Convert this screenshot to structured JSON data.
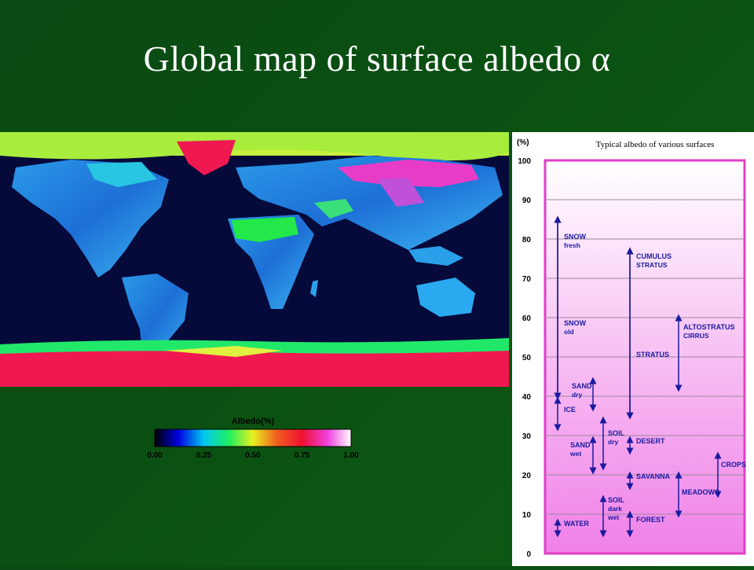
{
  "slide": {
    "title": "Global map of surface albedo α"
  },
  "legend": {
    "title": "Albedo(%)",
    "ticks": [
      "0.00",
      "0.25",
      "0.50",
      "0.75",
      "1.00"
    ]
  },
  "chart": {
    "caption": "Typical albedo of various surfaces",
    "unit_label": "(%)",
    "y_ticks": [
      "100",
      "90",
      "80",
      "70",
      "60",
      "50",
      "40",
      "30",
      "20",
      "10",
      "0"
    ],
    "colors": {
      "frame": "#e040c8",
      "arrow": "#1a1aa0",
      "label": "#1a1aa0",
      "fill_top": "#ffffff",
      "fill_bottom": "#f080e8"
    }
  },
  "chart_data": {
    "type": "range",
    "ylabel": "(%)",
    "ylim": [
      0,
      100
    ],
    "caption": "Typical albedo of various surfaces",
    "ranges": [
      {
        "label": [
          "SNOW",
          "fresh"
        ],
        "low": 40,
        "high": 85
      },
      {
        "label": [
          "SNOW",
          "old"
        ],
        "low": 40,
        "high": 85
      },
      {
        "label": [
          "CUMULUS",
          "STRATUS"
        ],
        "low": 35,
        "high": 77
      },
      {
        "label": [
          "STRATUS"
        ],
        "low": 35,
        "high": 77
      },
      {
        "label": [
          "ALTOSTRATUS",
          "CIRRUS"
        ],
        "low": 42,
        "high": 60
      },
      {
        "label": [
          "SAND",
          "dry"
        ],
        "low": 37,
        "high": 44
      },
      {
        "label": [
          "ICE"
        ],
        "low": 32,
        "high": 39
      },
      {
        "label": [
          "SAND",
          "wet"
        ],
        "low": 21,
        "high": 29
      },
      {
        "label": [
          "SOIL",
          "dry"
        ],
        "low": 22,
        "high": 34
      },
      {
        "label": [
          "DESERT"
        ],
        "low": 26,
        "high": 29
      },
      {
        "label": [
          "CROPS"
        ],
        "low": 15,
        "high": 25
      },
      {
        "label": [
          "SAVANNA"
        ],
        "low": 17,
        "high": 20
      },
      {
        "label": [
          "MEADOWS"
        ],
        "low": 10,
        "high": 20
      },
      {
        "label": [
          "SOIL",
          "dark",
          "wet"
        ],
        "low": 5,
        "high": 14
      },
      {
        "label": [
          "FOREST"
        ],
        "low": 5,
        "high": 10
      },
      {
        "label": [
          "WATER"
        ],
        "low": 5,
        "high": 8
      }
    ]
  }
}
